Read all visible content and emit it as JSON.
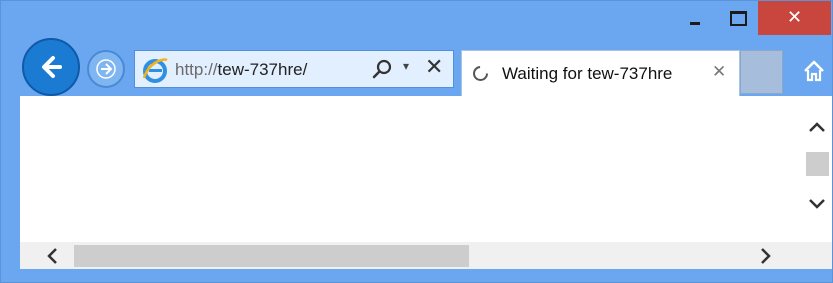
{
  "window": {
    "buttons": {
      "minimize_icon": "minimize-icon",
      "maximize_icon": "maximize-icon",
      "close_glyph": "✕"
    },
    "colors": {
      "frame": "#6aa7f0",
      "close_button": "#c8463e",
      "back_button": "#1b7ad1"
    }
  },
  "nav": {
    "address": {
      "protocol": "http://",
      "host": "tew-737hre/",
      "stop_glyph": "✕",
      "dropdown_glyph": "▾"
    }
  },
  "tab": {
    "title": "Waiting for tew-737hre",
    "close_glyph": "✕"
  }
}
